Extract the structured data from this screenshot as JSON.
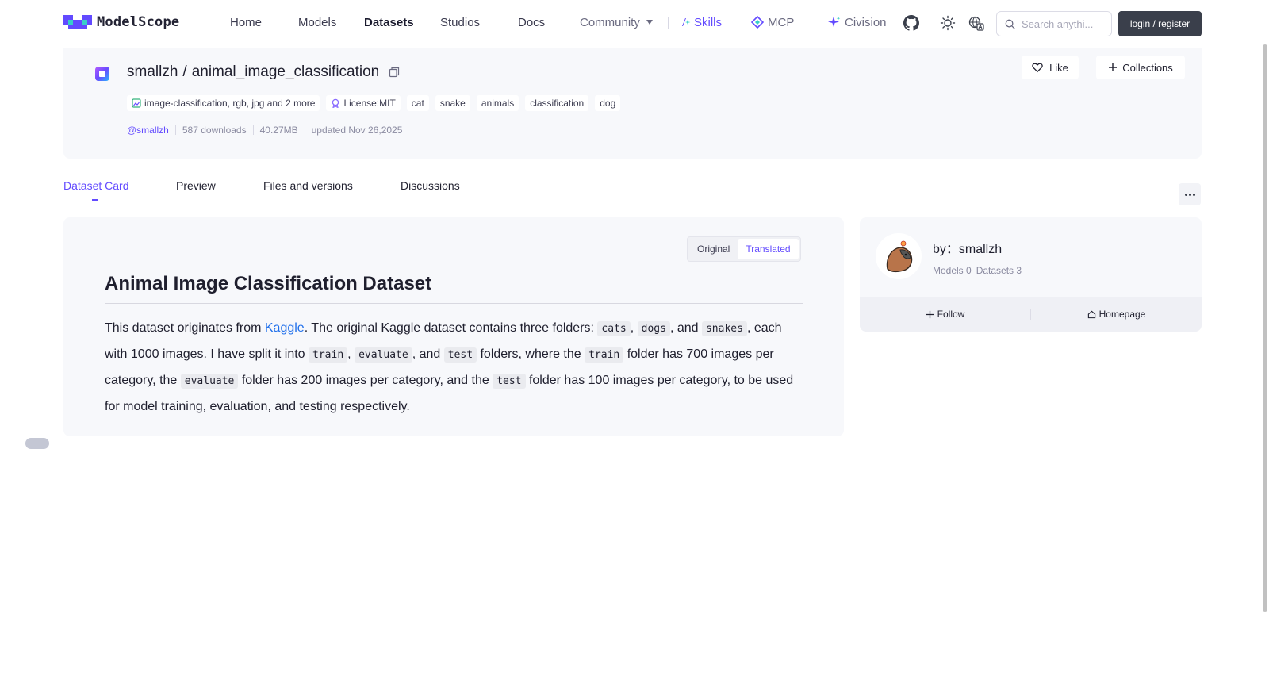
{
  "brand": {
    "logo_text": "ModelScope"
  },
  "nav": {
    "home": "Home",
    "models": "Models",
    "datasets": "Datasets",
    "studios": "Studios",
    "docs": "Docs",
    "community": "Community",
    "skills": "Skills",
    "mcp": "MCP",
    "civision": "Civision",
    "search_placeholder": "Search anythi...",
    "login": "login / register"
  },
  "dataset": {
    "owner": "smallzh",
    "name": "animal_image_classification",
    "tags": [
      "image-classification, rgb, jpg and 2 more",
      "License:MIT",
      "cat",
      "snake",
      "animals",
      "classification",
      "dog"
    ],
    "author_handle": "@smallzh",
    "downloads": "587 downloads",
    "size": "40.27MB",
    "updated": "updated Nov 26,2025",
    "like_label": "Like",
    "collections_label": "Collections"
  },
  "tabs": [
    "Dataset Card",
    "Preview",
    "Files and versions",
    "Discussions"
  ],
  "card": {
    "toggle_original": "Original",
    "toggle_translated": "Translated",
    "title": "Animal Image Classification Dataset",
    "body": {
      "p1": "This dataset originates from ",
      "link": "Kaggle",
      "p2": ". The original Kaggle dataset contains three folders: ",
      "c_cats": "cats",
      "s1": ", ",
      "c_dogs": "dogs",
      "s2": ", and ",
      "c_snakes": "snakes",
      "p3": ", each with 1000 images. I have split it into ",
      "c_train": "train",
      "s3": ", ",
      "c_evaluate": "evaluate",
      "s4": ", and ",
      "c_test": "test",
      "p4": " folders, where the ",
      "c_train2": "train",
      "p5": " folder has 700 images per category, the ",
      "c_evaluate2": "evaluate",
      "p6": " folder has 200 images per category, and the ",
      "c_test2": "test",
      "p7": " folder has 100 images per category, to be used for model training, evaluation, and testing respectively."
    }
  },
  "profile": {
    "by_label": "by：smallzh",
    "models": "Models 0",
    "datasets": "Datasets 3",
    "follow": "Follow",
    "homepage": "Homepage"
  },
  "colors": {
    "accent": "#624aff",
    "link": "#1f6feb",
    "login_bg": "#3a3f4b"
  }
}
